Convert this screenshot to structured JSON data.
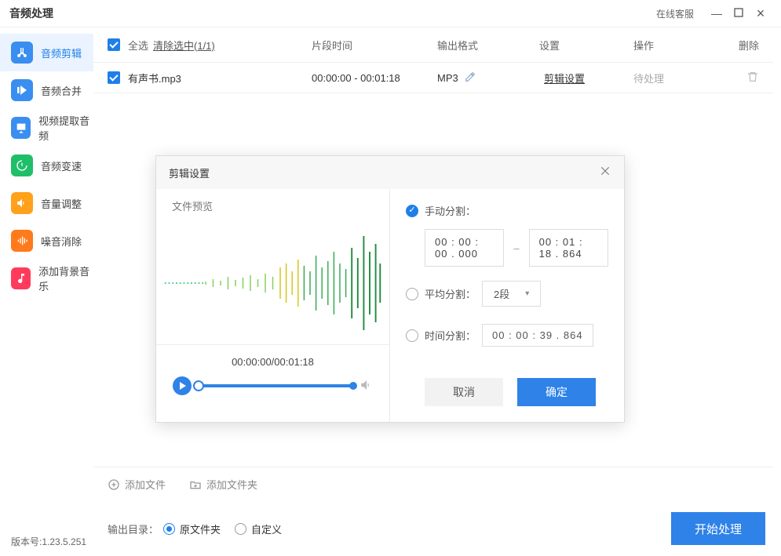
{
  "titlebar": {
    "title": "音频处理",
    "support": "在线客服"
  },
  "sidebar": [
    {
      "label": "音频剪辑",
      "color": "#3a8ef0"
    },
    {
      "label": "音频合并",
      "color": "#3a8ef0"
    },
    {
      "label": "视频提取音频",
      "color": "#3a8ef0"
    },
    {
      "label": "音频变速",
      "color": "#1fbf6a"
    },
    {
      "label": "音量调整",
      "color": "#ffa11a"
    },
    {
      "label": "噪音消除",
      "color": "#ff7a1a"
    },
    {
      "label": "添加背景音乐",
      "color": "#ff3b5c"
    }
  ],
  "table": {
    "select_all": "全选",
    "clear_sel": "清除选中(1/1)",
    "cols": {
      "time": "片段时间",
      "format": "输出格式",
      "settings": "设置",
      "action": "操作",
      "delete": "删除"
    },
    "row": {
      "filename": "有声书.mp3",
      "time": "00:00:00 - 00:01:18",
      "format": "MP3",
      "settings": "剪辑设置",
      "action": "待处理"
    }
  },
  "addbar": {
    "add_file": "添加文件",
    "add_folder": "添加文件夹"
  },
  "output": {
    "label": "输出目录：",
    "original": "原文件夹",
    "custom": "自定义",
    "start": "开始处理"
  },
  "version": "版本号:1.23.5.251",
  "modal": {
    "title": "剪辑设置",
    "preview_title": "文件预览",
    "player_time": "00:00:00/00:01:18",
    "manual": "手动分割：",
    "manual_start": "00 : 00 : 00 . 000",
    "manual_end": "00 : 01 : 18 . 864",
    "average": "平均分割：",
    "average_value": "2段",
    "bytime": "时间分割：",
    "bytime_value": "00 : 00 : 39 . 864",
    "cancel": "取消",
    "ok": "确定"
  }
}
